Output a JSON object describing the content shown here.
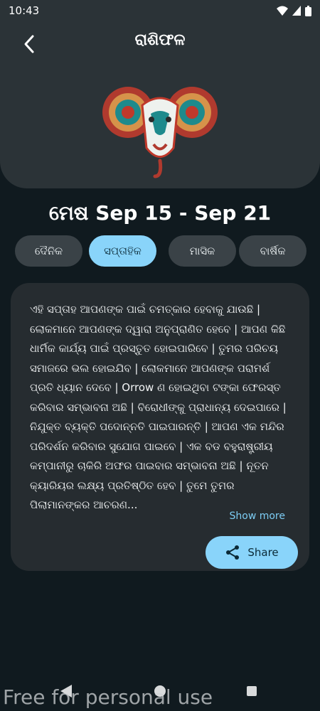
{
  "status": {
    "time": "10:43"
  },
  "header": {
    "title": "ରାଶିଫଳ"
  },
  "sign": {
    "heading": "ମେଷ Sep 15 - Sep 21"
  },
  "tabs": [
    {
      "label": "ଦୈନିକ",
      "active": false
    },
    {
      "label": "ସପ୍ତାହିକ",
      "active": true
    },
    {
      "label": "ମାସିକ",
      "active": false
    },
    {
      "label": "ବାର୍ଷିକ",
      "active": false
    }
  ],
  "card": {
    "text": "ଏହି ସପ୍ତାହ ଆପଣଙ୍କ ପାଇଁ ଚମତ୍କାର ହେବାକୁ ଯାଉଛି | ଲୋକମାନେ ଆପଣଙ୍କ ଦ୍ୱାରା ଅନୁପ୍ରାଣିତ ହେବେ | ଆପଣ କିଛି ଧାର୍ମିକ କାର୍ଯ୍ୟ ପାଇଁ ପ୍ରସ୍ତୁତ ହୋଇପାରିବେ | ତୁମର ପରିଚୟ ସମାଜରେ ଭଲ ହୋଇଯିବ | ଲୋକମାନେ ଆପଣଙ୍କ ପରାମର୍ଶ ପ୍ରତି ଧ୍ୟାନ ଦେବେ | Orrow ଣ ହୋଇଥିବା ଟଙ୍କା ଫେରସ୍ତ କରିବାର ସମ୍ଭାବନା ଅଛି | ବିରୋଧୀଙ୍କୁ ପ୍ରାଧାନ୍ୟ ଦେଇପାରେ | ନିଯୁକ୍ତ ବ୍ୟକ୍ତି ପଦୋନ୍ନତି ପାଇପାରନ୍ତି | ଆପଣ ଏକ ମନ୍ଦିର ପରିଦର୍ଶନ କରିବାର ସୁଯୋଗ ପାଇବେ | ଏକ ବଡ ବହୁରାଷ୍ଟ୍ରୀୟ କମ୍ପାନୀରୁ ଚାକିରି ଅଫର ପାଇବାର ସମ୍ଭାବନା ଅଛି | ନୂତନ କ୍ୟାରିୟର ଲକ୍ଷ୍ୟ ପ୍ରତିଷ୍ଠିତ ହେବ | ତୁମେ ତୁମର ପିଲାମାନଙ୍କର ଆଚରଣ...",
    "show_more": "Show more",
    "share": "Share"
  },
  "watermark": "Free for personal use",
  "colors": {
    "background": "#101a1f",
    "header": "#2b3337",
    "accent": "#89d4fa",
    "card": "#262c30"
  }
}
